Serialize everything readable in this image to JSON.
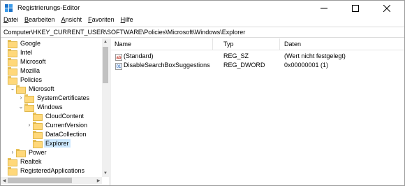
{
  "window": {
    "title": "Registrierungs-Editor",
    "icon": "regedit-icon"
  },
  "menu": {
    "items": [
      {
        "ul": "D",
        "rest": "atei"
      },
      {
        "ul": "B",
        "rest": "earbeiten"
      },
      {
        "ul": "A",
        "rest": "nsicht"
      },
      {
        "ul": "F",
        "rest": "avoriten"
      },
      {
        "ul": "H",
        "rest": "ilfe"
      }
    ]
  },
  "address": {
    "path": "Computer\\HKEY_CURRENT_USER\\SOFTWARE\\Policies\\Microsoft\\Windows\\Explorer"
  },
  "tree": {
    "nodes": [
      {
        "label": "Google",
        "level": 0,
        "chevron": ""
      },
      {
        "label": "Intel",
        "level": 0,
        "chevron": ""
      },
      {
        "label": "Microsoft",
        "level": 0,
        "chevron": ""
      },
      {
        "label": "Mozilla",
        "level": 0,
        "chevron": ""
      },
      {
        "label": "Policies",
        "level": 0,
        "chevron": ""
      },
      {
        "label": "Microsoft",
        "level": 1,
        "chevron": "expanded"
      },
      {
        "label": "SystemCertificates",
        "level": 2,
        "chevron": "collapsed"
      },
      {
        "label": "Windows",
        "level": 2,
        "chevron": "expanded"
      },
      {
        "label": "CloudContent",
        "level": 3,
        "chevron": ""
      },
      {
        "label": "CurrentVersion",
        "level": 3,
        "chevron": "collapsed"
      },
      {
        "label": "DataCollection",
        "level": 3,
        "chevron": ""
      },
      {
        "label": "Explorer",
        "level": 3,
        "chevron": "",
        "selected": true
      },
      {
        "label": "Power",
        "level": 1,
        "chevron": "collapsed"
      },
      {
        "label": "Realtek",
        "level": 0,
        "chevron": ""
      },
      {
        "label": "RegisteredApplications",
        "level": 0,
        "chevron": ""
      }
    ]
  },
  "list": {
    "columns": [
      "Name",
      "Typ",
      "Daten"
    ],
    "rows": [
      {
        "icon": "string-value-icon",
        "name": "(Standard)",
        "type": "REG_SZ",
        "data": "(Wert nicht festgelegt)"
      },
      {
        "icon": "binary-value-icon",
        "name": "DisableSearchBoxSuggestions",
        "type": "REG_DWORD",
        "data": "0x00000001 (1)"
      }
    ]
  },
  "colors": {
    "selection": "#cce8ff",
    "folder": "#ffd87a"
  }
}
